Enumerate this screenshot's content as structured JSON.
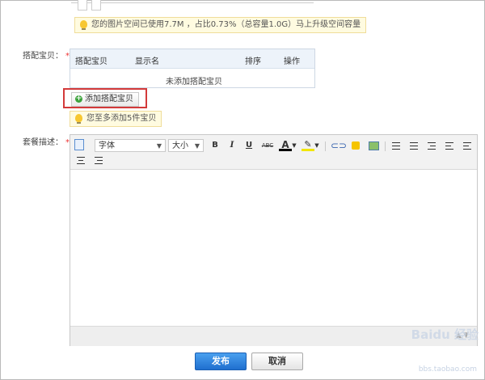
{
  "space_tip": "您的图片空间已使用7.7M ，占比0.73%（总容量1.0G）马上升级空间容量",
  "goods_section": {
    "label": "搭配宝贝：",
    "required_mark": "*",
    "columns": [
      "搭配宝贝",
      "显示名",
      "排序",
      "操作"
    ],
    "empty_text": "未添加搭配宝贝",
    "add_button": "添加搭配宝贝",
    "limit_tip": "您至多添加5件宝贝"
  },
  "description_section": {
    "label": "套餐描述：",
    "required_mark": "*"
  },
  "editor": {
    "font_select": "字体",
    "size_select": "大小",
    "bold": "B",
    "italic": "I",
    "underline": "U",
    "strike": "ABC",
    "font_color": "A"
  },
  "actions": {
    "publish": "发布",
    "cancel": "取消"
  },
  "watermark": {
    "brand": "Baidu 经验",
    "url": "bbs.taobao.com"
  },
  "colors": {
    "accent_blue": "#2a7de0",
    "required_red": "#e33333",
    "highlight_red": "#d33a3a",
    "tip_yellow": "#fffbe0"
  }
}
